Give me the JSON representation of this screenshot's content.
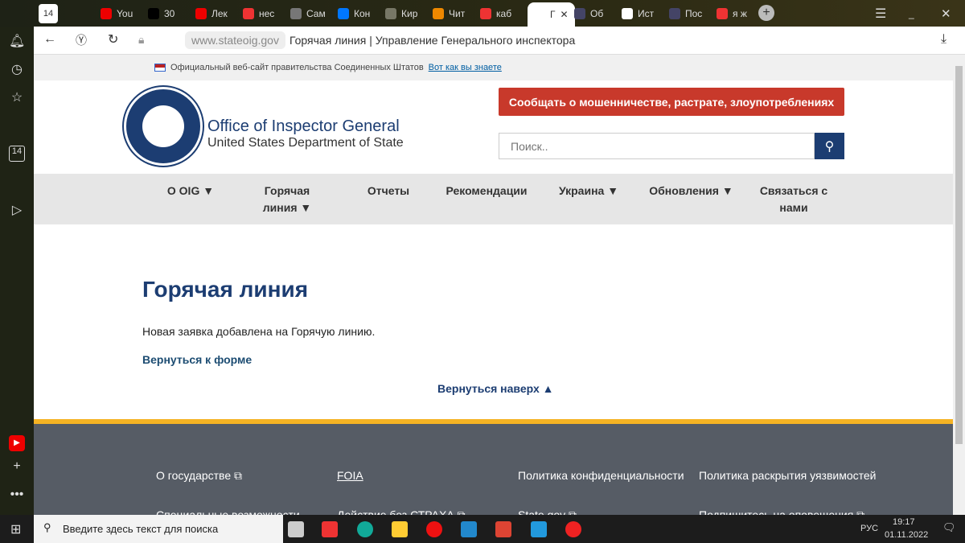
{
  "tabs": [
    {
      "label": "You",
      "color": "#e00"
    },
    {
      "label": "30",
      "color": "#000"
    },
    {
      "label": "Лек",
      "color": "#e00"
    },
    {
      "label": "нес",
      "color": "#e33"
    },
    {
      "label": "Сам",
      "color": "#777"
    },
    {
      "label": "Кон",
      "color": "#07f"
    },
    {
      "label": "Кир",
      "color": "#776"
    },
    {
      "label": "Чит",
      "color": "#e80"
    },
    {
      "label": "каб",
      "color": "#e33"
    },
    {
      "label": "Г",
      "color": "#fff",
      "active": true
    },
    {
      "label": "Об",
      "color": "#446"
    },
    {
      "label": "Ист",
      "color": "#fff"
    },
    {
      "label": "Пос",
      "color": "#446"
    },
    {
      "label": "я ж",
      "color": "#e33"
    }
  ],
  "sidebar_badge": "14",
  "address": {
    "url": "www.stateoig.gov",
    "title": "Горячая линия | Управление Генерального инспектора"
  },
  "gov_banner": {
    "text": "Официальный веб-сайт правительства Соединенных Штатов",
    "link": "Вот как вы знаете"
  },
  "header": {
    "title": "Office of Inspector General",
    "subtitle": "United States Department of State",
    "report_button": "Сообщать о мошенничестве, растрате, злоупотреблениях",
    "search_placeholder": "Поиск.."
  },
  "nav": [
    {
      "label": "О OIG ▼"
    },
    {
      "label": "Горячая линия ▼"
    },
    {
      "label": "Отчеты"
    },
    {
      "label": "Рекомендации"
    },
    {
      "label": "Украина ▼"
    },
    {
      "label": "Обновления ▼"
    },
    {
      "label": "Связаться с нами"
    }
  ],
  "main": {
    "heading": "Горячая линия",
    "message": "Новая заявка добавлена на Горячую линию.",
    "back_link": "Вернуться к форме",
    "top_link": "Вернуться наверх ▲"
  },
  "footer": [
    {
      "label": "О государстве ⧉"
    },
    {
      "label": "FOIA"
    },
    {
      "label": "Политика конфиденциальности"
    },
    {
      "label": "Политика раскрытия уязвимостей"
    },
    {
      "label": "Специальные возможности"
    },
    {
      "label": "Действие без СТРАХА ⧉"
    },
    {
      "label": "State.gov ⧉"
    },
    {
      "label": "Подпишитесь на оповещения ⧉"
    }
  ],
  "taskbar": {
    "search_placeholder": "Введите здесь текст для поиска",
    "lang": "РУС",
    "time": "19:17",
    "date": "01.11.2022"
  },
  "colors": {
    "accent": "#1c3d72",
    "report": "#c8392b",
    "footer": "#565c65",
    "footer_border": "#f5b324"
  }
}
